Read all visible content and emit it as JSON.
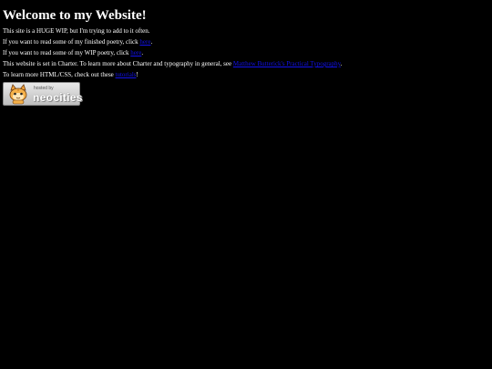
{
  "heading": "Welcome to my Website!",
  "lines": [
    {
      "before": "This site is a HUGE WIP, but I'm trying to add to it often.",
      "link": "",
      "after": ""
    },
    {
      "before": "If you want to read some of my finished poetry, click ",
      "link": "here",
      "after": "."
    },
    {
      "before": "If you want to read some of my WIP poetry, click ",
      "link": "here",
      "after": "."
    },
    {
      "before": "This website is set in Charter. To learn more about Charter and typography in general, see ",
      "link": "Matthew Butterick's Practical Typography",
      "after": "."
    },
    {
      "before": "To learn more HTML/CSS, check out these ",
      "link": "tutorials",
      "after": "!"
    }
  ],
  "badge": {
    "hosted_label": "hosted by",
    "brand_label": "neocities",
    "icon": "neocities-cat-icon"
  },
  "colors": {
    "background": "#000000",
    "text": "#ffffff",
    "link": "#1111ee"
  }
}
